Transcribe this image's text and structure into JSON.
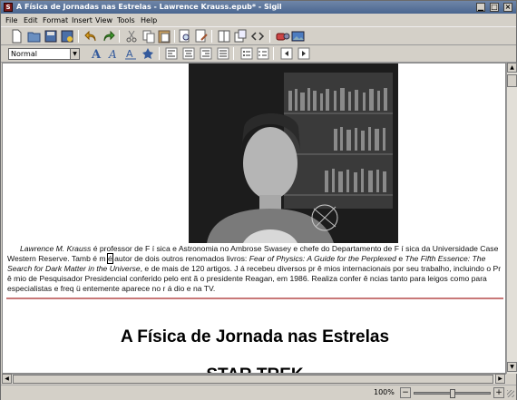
{
  "window": {
    "title": "A Física de Jornadas nas Estrelas - Lawrence Krauss.epub* - Sigil",
    "app_icon_letter": "S"
  },
  "menu": {
    "items": [
      {
        "label": "File"
      },
      {
        "label": "Edit"
      },
      {
        "label": "Format"
      },
      {
        "label": "Insert"
      },
      {
        "label": "View"
      },
      {
        "label": "Tools"
      },
      {
        "label": "Help"
      }
    ]
  },
  "toolbar": {
    "style_value": "Normal",
    "icons": [
      "new-file-icon",
      "open-folder-icon",
      "save-icon",
      "save-as-icon",
      "undo-icon",
      "redo-icon",
      "cut-icon",
      "copy-icon",
      "paste-icon",
      "find-icon",
      "find-replace-icon",
      "book-view-icon",
      "split-view-icon",
      "code-view-icon",
      "spellcheck-icon",
      "insert-image-icon"
    ]
  },
  "format_toolbar": {
    "icons": [
      "heading-1-icon",
      "heading-2-icon",
      "heading-3-icon",
      "heading-4-icon",
      "align-left-icon",
      "align-center-icon",
      "align-right-icon",
      "align-justify-icon",
      "bullet-list-icon",
      "number-list-icon",
      "decrease-indent-icon",
      "increase-indent-icon"
    ]
  },
  "document": {
    "para_author": "Lawrence M. Krauss",
    "para_1": " é professor de F í sica e Astronomia no Ambrose Swasey e chefe do Departamento de F í sica da Universidade Case Western Reserve. Tamb é m ",
    "para_cursor_word": "é",
    "para_2": " autor de dois outros renomados livros: ",
    "book_1": "Fear of Physics: A Guide for the Perplexed",
    "para_3": " e ",
    "book_2": "The Fifth Essence: The Search for Dark Matter in the Universe",
    "para_4": ", e de mais de 120 artigos. J á recebeu diversos pr ê mios internacionais por seu trabalho, incluindo o Pr ê mio de Pesquisador Presidencial conferido pelo ent ã o presidente Reagan, em 1986. Realiza confer ê ncias tanto para leigos como para especialistas e freq ü entemente aparece no r á dio e na TV.",
    "heading_1": "A Física de Jornada nas Estrelas",
    "heading_2": "STAR TREK"
  },
  "status": {
    "zoom": "100%",
    "zoom_minus": "−",
    "zoom_plus": "+",
    "zoom_slider_value": 0.5
  }
}
